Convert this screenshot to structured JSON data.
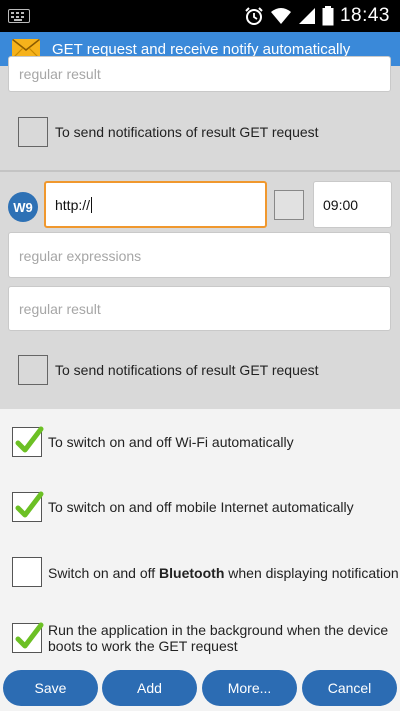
{
  "status_bar": {
    "time": "18:43",
    "icons": [
      "keyboard-icon",
      "alarm-icon",
      "wifi-icon",
      "signal-icon",
      "battery-icon"
    ]
  },
  "action_bar": {
    "title": "GET request and receive notify automatically",
    "icon": "envelope-icon"
  },
  "entry_prev": {
    "result_placeholder": "regular result",
    "notify_label": "To send notifications of result GET request",
    "notify_checked": false
  },
  "entry_w9": {
    "badge": "W9",
    "url_value": "http://",
    "enabled_checked": false,
    "time_value": "09:00",
    "regex_placeholder": "regular expressions",
    "result_placeholder": "regular result",
    "notify_label": "To send notifications of result GET request",
    "notify_checked": false
  },
  "options": [
    {
      "label": "To switch on and off Wi-Fi automatically",
      "checked": true
    },
    {
      "label": "To switch on and off mobile Internet automatically",
      "checked": true
    },
    {
      "label_prefix": "Switch on and off ",
      "label_bold": "Bluetooth",
      "label_suffix": " when displaying notification",
      "checked": false
    },
    {
      "label_line1": "Run the application in the background when the device",
      "label_line2": "boots to work the GET request",
      "checked": true
    }
  ],
  "buttons": {
    "save": "Save",
    "add": "Add",
    "more": "More...",
    "cancel": "Cancel"
  },
  "colors": {
    "action_bar": "#3a89d9",
    "button": "#2c6cb3",
    "badge": "#2e71b5",
    "focus_border": "#f0982e",
    "check_green": "#6cc024"
  }
}
